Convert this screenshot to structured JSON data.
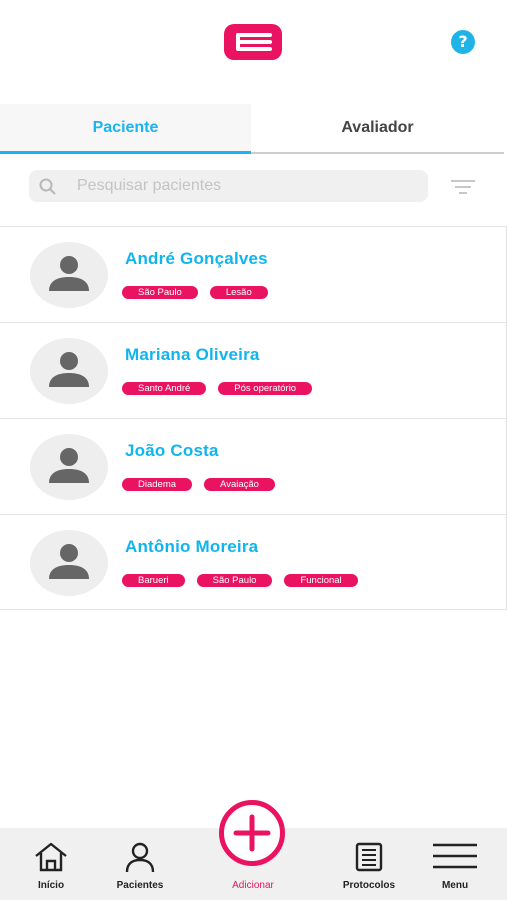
{
  "header": {
    "logo_icon": "brand-logo-icon",
    "help_label": "?"
  },
  "tabs": [
    {
      "label": "Paciente",
      "active": true
    },
    {
      "label": "Avaliador",
      "active": false
    }
  ],
  "search": {
    "placeholder": "Pesquisar pacientes"
  },
  "patients": [
    {
      "name": "André Gonçalves",
      "tags": [
        "São Paulo",
        "Lesão"
      ]
    },
    {
      "name": "Mariana Oliveira",
      "tags": [
        "Santo André",
        "Pós operatório"
      ]
    },
    {
      "name": "João Costa",
      "tags": [
        "Diadema",
        "Avaiação"
      ]
    },
    {
      "name": "Antônio Moreira",
      "tags": [
        "Barueri",
        "São Paulo",
        "Funcional"
      ]
    }
  ],
  "bottom_nav": [
    {
      "label": "Início",
      "icon": "home-icon"
    },
    {
      "label": "Pacientes",
      "icon": "person-icon"
    },
    {
      "label": "Adicionar",
      "icon": "plus-icon"
    },
    {
      "label": "Protocolos",
      "icon": "document-icon"
    },
    {
      "label": "Menu",
      "icon": "menu-icon"
    }
  ],
  "colors": {
    "accent_blue": "#19b5f0",
    "brand_pink": "#ea1361"
  }
}
